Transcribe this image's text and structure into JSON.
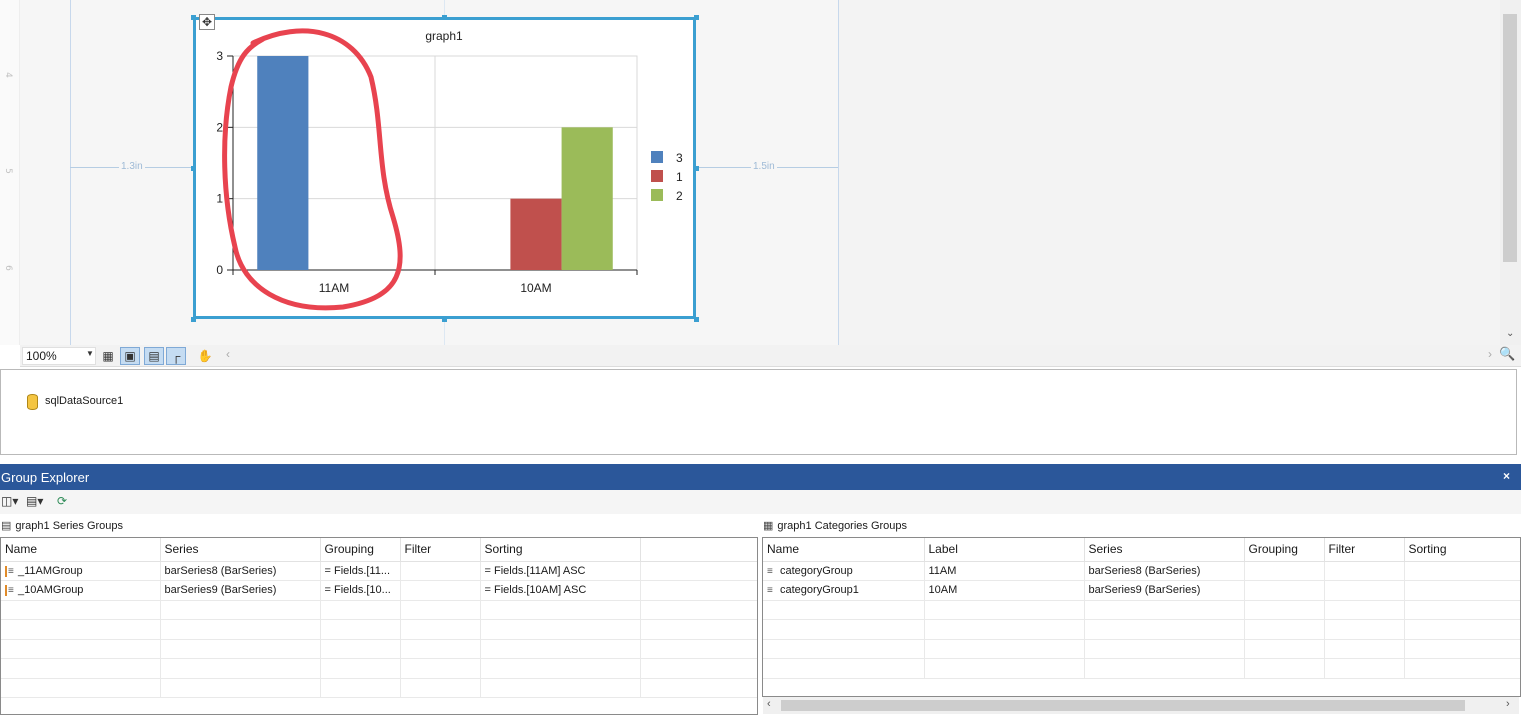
{
  "designer": {
    "ruler_numbers": [
      "4",
      "5",
      "6"
    ],
    "left_margin_label": "1.3in",
    "right_margin_label": "1.5in"
  },
  "chart_data": {
    "type": "bar",
    "title": "graph1",
    "categories": [
      "11AM",
      "10AM"
    ],
    "series": [
      {
        "name": "3",
        "color": "#4f81bd",
        "values": [
          3,
          null
        ]
      },
      {
        "name": "1",
        "color": "#c0504d",
        "values": [
          null,
          1
        ]
      },
      {
        "name": "2",
        "color": "#9bbb59",
        "values": [
          null,
          2
        ]
      }
    ],
    "y_ticks": [
      "0",
      "1",
      "2",
      "3"
    ],
    "ylim": [
      0,
      3
    ],
    "grid": true,
    "legend_position": "right",
    "annotation_color": "#e8434f"
  },
  "zoom_bar": {
    "zoom_value": "100%"
  },
  "data_sources": {
    "items": [
      "sqlDataSource1"
    ]
  },
  "group_explorer": {
    "title": "Group Explorer",
    "close_glyph": "×",
    "series_groups": {
      "caption": "graph1 Series Groups",
      "columns": [
        "Name",
        "Series",
        "Grouping",
        "Filter",
        "Sorting"
      ],
      "rows": [
        [
          "_11AMGroup",
          "barSeries8 (BarSeries)",
          "= Fields.[11...",
          "",
          "= Fields.[11AM] ASC"
        ],
        [
          "_10AMGroup",
          "barSeries9 (BarSeries)",
          "= Fields.[10...",
          "",
          "= Fields.[10AM] ASC"
        ]
      ]
    },
    "category_groups": {
      "caption": "graph1 Categories Groups",
      "columns": [
        "Name",
        "Label",
        "Series",
        "Grouping",
        "Filter",
        "Sorting"
      ],
      "rows": [
        [
          "categoryGroup",
          "11AM",
          "barSeries8 (BarSeries)",
          "",
          "",
          ""
        ],
        [
          "categoryGroup1",
          "10AM",
          "barSeries9 (BarSeries)",
          "",
          "",
          ""
        ]
      ]
    }
  }
}
